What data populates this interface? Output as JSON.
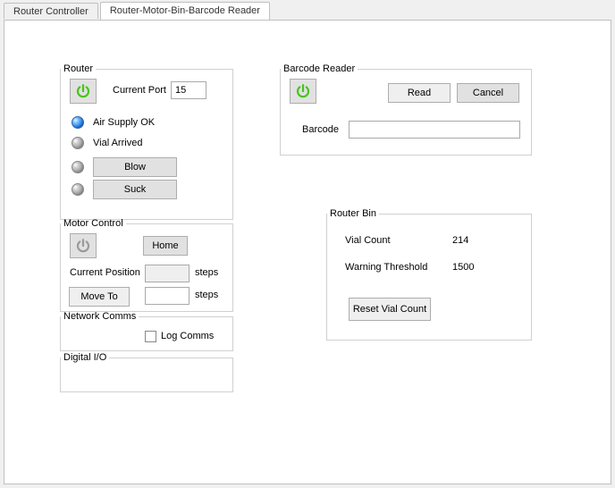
{
  "tabs": {
    "controller": "Router Controller",
    "rmb": "Router-Motor-Bin-Barcode Reader"
  },
  "router": {
    "legend": "Router",
    "current_port_label": "Current Port",
    "current_port_value": "15",
    "air_supply_label": "Air Supply OK",
    "vial_arrived_label": "Vial Arrived",
    "blow_label": "Blow",
    "suck_label": "Suck"
  },
  "motor": {
    "legend": "Motor Control",
    "home_label": "Home",
    "current_position_label": "Current Position",
    "current_position_value": "",
    "steps_unit": "steps",
    "move_to_label": "Move To",
    "move_to_value": ""
  },
  "network": {
    "legend": "Network Comms",
    "log_comms_label": "Log Comms"
  },
  "digital_io": {
    "legend": "Digital I/O"
  },
  "barcode": {
    "legend": "Barcode Reader",
    "read_label": "Read",
    "cancel_label": "Cancel",
    "barcode_label": "Barcode",
    "barcode_value": ""
  },
  "router_bin": {
    "legend": "Router Bin",
    "vial_count_label": "Vial Count",
    "vial_count_value": "214",
    "warning_threshold_label": "Warning Threshold",
    "warning_threshold_value": "1500",
    "reset_label": "Reset Vial Count"
  },
  "colors": {
    "power_on": "#6fdc3f",
    "power_off": "#b5b5b5"
  }
}
